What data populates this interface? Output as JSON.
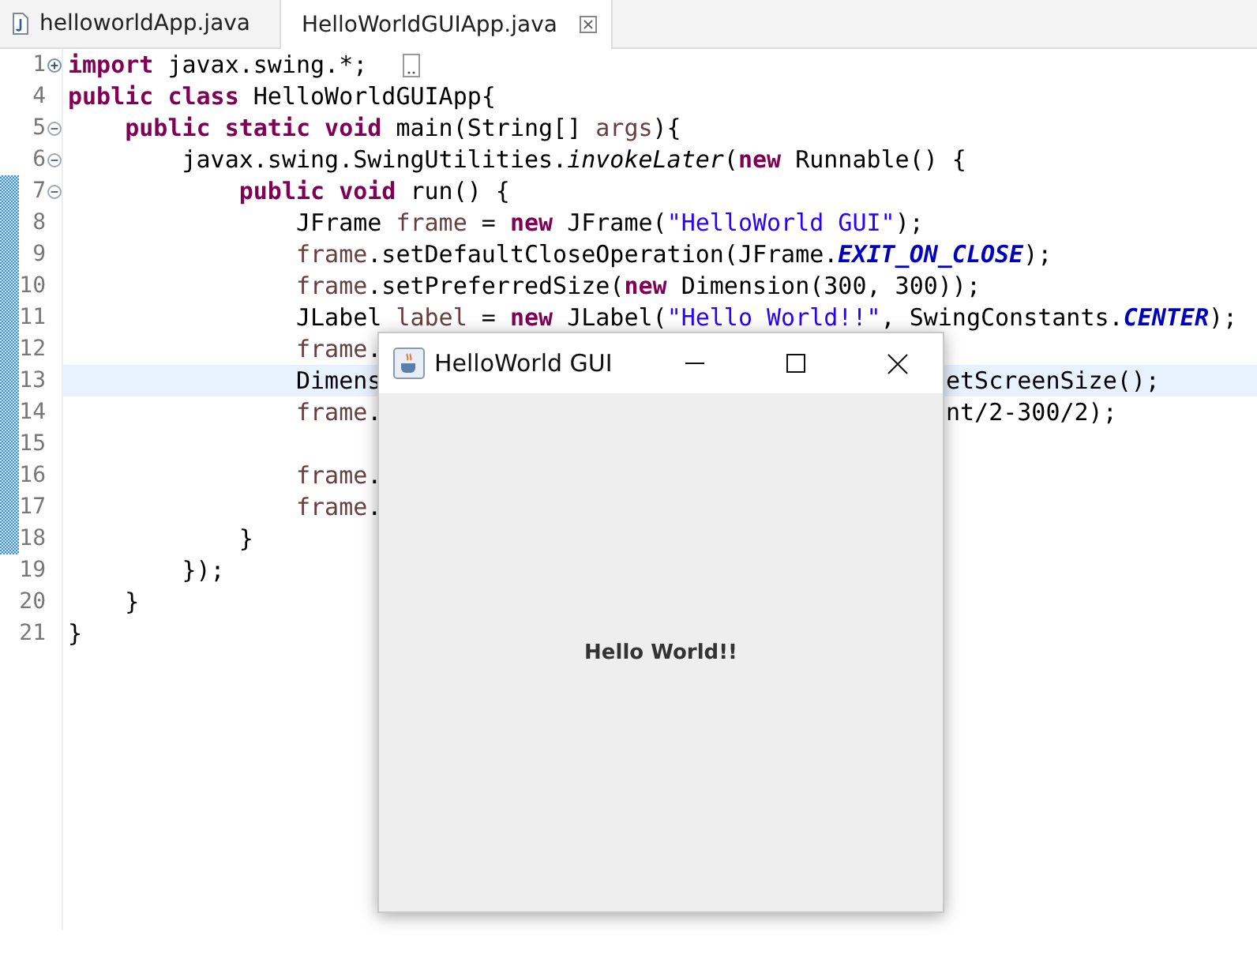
{
  "tabs": [
    {
      "label": "helloworldApp.java",
      "selected": false
    },
    {
      "label": "HelloWorldGUIApp.java",
      "selected": true
    }
  ],
  "editor": {
    "lines": [
      {
        "number": "1",
        "folded": true,
        "tokens": [
          {
            "kind": "keyword",
            "text": "import"
          },
          {
            "kind": "plain",
            "text": " javax.swing.*;"
          }
        ]
      },
      {
        "number": "4",
        "tokens": [
          {
            "kind": "keyword",
            "text": "public class"
          },
          {
            "kind": "plain",
            "text": " HelloWorldGUIApp{"
          }
        ]
      },
      {
        "number": "5",
        "folded": false,
        "tokens": [
          {
            "kind": "keyword",
            "text": "    public static void"
          },
          {
            "kind": "plain",
            "text": " main(String[] "
          },
          {
            "kind": "variable",
            "text": "args"
          },
          {
            "kind": "plain",
            "text": "){"
          }
        ]
      },
      {
        "number": "6",
        "folded": false,
        "tokens": [
          {
            "kind": "plain",
            "text": "        javax.swing.SwingUtilities."
          },
          {
            "kind": "static-method",
            "text": "invokeLater"
          },
          {
            "kind": "plain",
            "text": "("
          },
          {
            "kind": "keyword",
            "text": "new"
          },
          {
            "kind": "plain",
            "text": " Runnable() {"
          }
        ]
      },
      {
        "number": "7",
        "folded": false,
        "range": true,
        "tokens": [
          {
            "kind": "keyword",
            "text": "            public void"
          },
          {
            "kind": "plain",
            "text": " run() {"
          }
        ]
      },
      {
        "number": "8",
        "range": true,
        "tokens": [
          {
            "kind": "plain",
            "text": "                JFrame "
          },
          {
            "kind": "variable",
            "text": "frame"
          },
          {
            "kind": "plain",
            "text": " = "
          },
          {
            "kind": "keyword",
            "text": "new"
          },
          {
            "kind": "plain",
            "text": " JFrame("
          },
          {
            "kind": "string",
            "text": "\"HelloWorld GUI\""
          },
          {
            "kind": "plain",
            "text": ");"
          }
        ]
      },
      {
        "number": "9",
        "range": true,
        "tokens": [
          {
            "kind": "variable",
            "text": "                frame"
          },
          {
            "kind": "plain",
            "text": ".setDefaultCloseOperation(JFrame."
          },
          {
            "kind": "constant",
            "text": "EXIT_ON_CLOSE"
          },
          {
            "kind": "plain",
            "text": ");"
          }
        ]
      },
      {
        "number": "10",
        "range": true,
        "tokens": [
          {
            "kind": "variable",
            "text": "                frame"
          },
          {
            "kind": "plain",
            "text": ".setPreferredSize("
          },
          {
            "kind": "keyword",
            "text": "new"
          },
          {
            "kind": "plain",
            "text": " Dimension(300, 300));"
          }
        ]
      },
      {
        "number": "11",
        "range": true,
        "tokens": [
          {
            "kind": "plain",
            "text": "                JLabel "
          },
          {
            "kind": "variable",
            "text": "label"
          },
          {
            "kind": "plain",
            "text": " = "
          },
          {
            "kind": "keyword",
            "text": "new"
          },
          {
            "kind": "plain",
            "text": " JLabel("
          },
          {
            "kind": "string",
            "text": "\"Hello World!!\""
          },
          {
            "kind": "plain",
            "text": ", SwingConstants."
          },
          {
            "kind": "constant",
            "text": "CENTER"
          },
          {
            "kind": "plain",
            "text": ");"
          }
        ]
      },
      {
        "number": "12",
        "range": true,
        "head": [
          {
            "kind": "variable",
            "text": "                frame"
          },
          {
            "kind": "plain",
            "text": "."
          }
        ]
      },
      {
        "number": "13",
        "range": true,
        "current": true,
        "head": [
          {
            "kind": "plain",
            "text": "                Dimens"
          }
        ],
        "tail": [
          {
            "kind": "plain",
            "text": "etScreenSize();"
          }
        ]
      },
      {
        "number": "14",
        "range": true,
        "head": [
          {
            "kind": "variable",
            "text": "                frame"
          },
          {
            "kind": "plain",
            "text": "."
          }
        ],
        "tail": [
          {
            "kind": "plain",
            "text": "nt/2-300/2);"
          }
        ]
      },
      {
        "number": "15",
        "range": true
      },
      {
        "number": "16",
        "range": true,
        "head": [
          {
            "kind": "variable",
            "text": "                frame"
          },
          {
            "kind": "plain",
            "text": "."
          }
        ]
      },
      {
        "number": "17",
        "range": true,
        "head": [
          {
            "kind": "variable",
            "text": "                frame"
          },
          {
            "kind": "plain",
            "text": "."
          }
        ]
      },
      {
        "number": "18",
        "range": true,
        "tokens": [
          {
            "kind": "plain",
            "text": "            }"
          }
        ]
      },
      {
        "number": "19",
        "tokens": [
          {
            "kind": "plain",
            "text": "        });"
          }
        ]
      },
      {
        "number": "20",
        "tokens": [
          {
            "kind": "plain",
            "text": "    }"
          }
        ]
      },
      {
        "number": "21",
        "tokens": [
          {
            "kind": "plain",
            "text": "}"
          }
        ]
      }
    ]
  },
  "dialog": {
    "title": "HelloWorld GUI",
    "label": "Hello World!!"
  }
}
